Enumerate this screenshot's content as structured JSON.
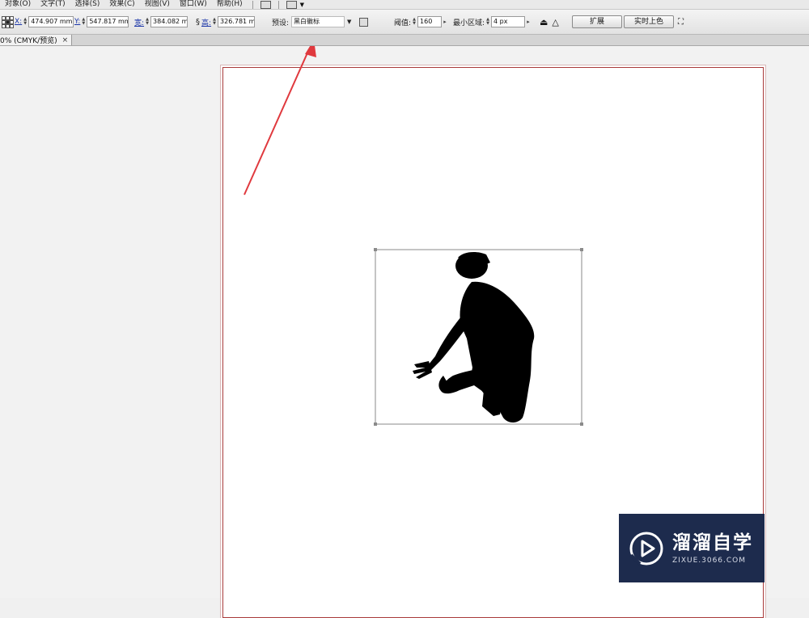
{
  "menu": {
    "items": [
      "对象(O)",
      "文字(T)",
      "选择(S)",
      "效果(C)",
      "视图(V)",
      "窗口(W)",
      "帮助(H)"
    ]
  },
  "controls": {
    "x_label": "X:",
    "x_value": "474.907 mm",
    "y_label": "Y:",
    "y_value": "547.817 mm",
    "w_label": "宽:",
    "w_value": "384.082 m",
    "h_label": "高:",
    "h_value": "326.781 m",
    "preset_label": "预设:",
    "preset_value": "黑白徽标",
    "threshold_label": "阈值:",
    "threshold_value": "160",
    "min_area_label": "最小区域:",
    "min_area_value": "4 px",
    "expand_button": "扩展",
    "live_paint_button": "实时上色"
  },
  "document": {
    "tab_title": "0% (CMYK/预览)",
    "tab_close": "×"
  },
  "watermark": {
    "name": "溜溜自学",
    "url": "ZIXUE.3066.COM",
    "bg_color": "#1d2b4d"
  },
  "annotation": {
    "arrow_color": "#e0393e"
  }
}
